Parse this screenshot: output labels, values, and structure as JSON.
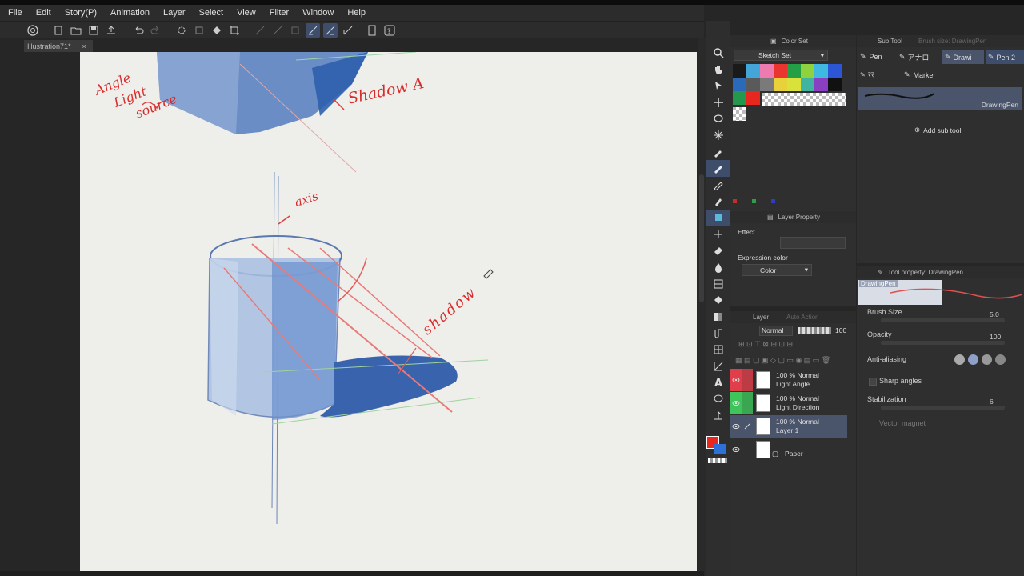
{
  "menu": [
    "File",
    "Edit",
    "Story(P)",
    "Animation",
    "Layer",
    "Select",
    "View",
    "Filter",
    "Window",
    "Help"
  ],
  "document_tab": "Illustration71*",
  "canvas_annotations": {
    "angle_light_source": [
      "Angle",
      "Light",
      "source"
    ],
    "shadow_a": "Shadow A",
    "axis": "axis",
    "shadow": "shadow"
  },
  "color_panel": {
    "tab": "Color Set",
    "set_name": "Sketch Set",
    "swatches": [
      "#1a1a1a",
      "#44a6d8",
      "#ee7bb0",
      "#e9342f",
      "#23a046",
      "#8ed33d",
      "#3fb9e0",
      "#2d56d6",
      "#2b6ab8",
      "#5a5a5a",
      "#7a7a7a",
      "#e8d13a",
      "#d8e23b",
      "#3fb4a1",
      "#8a3fc2",
      "#111111",
      "#24994d",
      "#e8281e"
    ],
    "mini_dots": [
      "#c0302b",
      "#2f9d4b",
      "#2f3ec0"
    ]
  },
  "layer_property": {
    "title": "Layer Property",
    "effect_label": "Effect",
    "expression_label": "Expression color",
    "expression_value": "Color"
  },
  "layer_panel": {
    "tab": "Layer",
    "tab2": "Auto Action",
    "blend": "Normal",
    "opacity": "100",
    "layers": [
      {
        "line1": "100 % Normal",
        "line2": "Light Angle",
        "eye_color": "#e03e4a",
        "selected": false
      },
      {
        "line1": "100 % Normal",
        "line2": "Light Direction",
        "eye_color": "#3ec45a",
        "selected": false
      },
      {
        "line1": "100 % Normal",
        "line2": "Layer 1",
        "eye_color": "",
        "selected": true
      },
      {
        "line1": "",
        "line2": "Paper",
        "eye_color": "",
        "selected": false
      }
    ]
  },
  "subtool": {
    "tab": "Sub Tool",
    "tab2": "Brush size: DrawingPen",
    "groups": [
      "Pen",
      "アナロ",
      "Drawi",
      "Pen 2",
      "ﾏﾏ",
      "Marker"
    ],
    "preview_label": "DrawingPen",
    "add_label": "Add sub tool"
  },
  "tool_property": {
    "title": "Tool property: DrawingPen",
    "preset": "DrawingPen",
    "props": [
      {
        "label": "Brush Size",
        "value": "5.0"
      },
      {
        "label": "Opacity",
        "value": "100"
      },
      {
        "label": "Anti-aliasing",
        "value": ""
      },
      {
        "label": "Sharp angles",
        "value": ""
      },
      {
        "label": "Stabilization",
        "value": "6"
      },
      {
        "label": "Vector magnet",
        "value": ""
      }
    ]
  },
  "colors": {
    "accent": "#3d4d6a",
    "main_color": "#e8281e",
    "sub_color": "#2f6fd8"
  }
}
